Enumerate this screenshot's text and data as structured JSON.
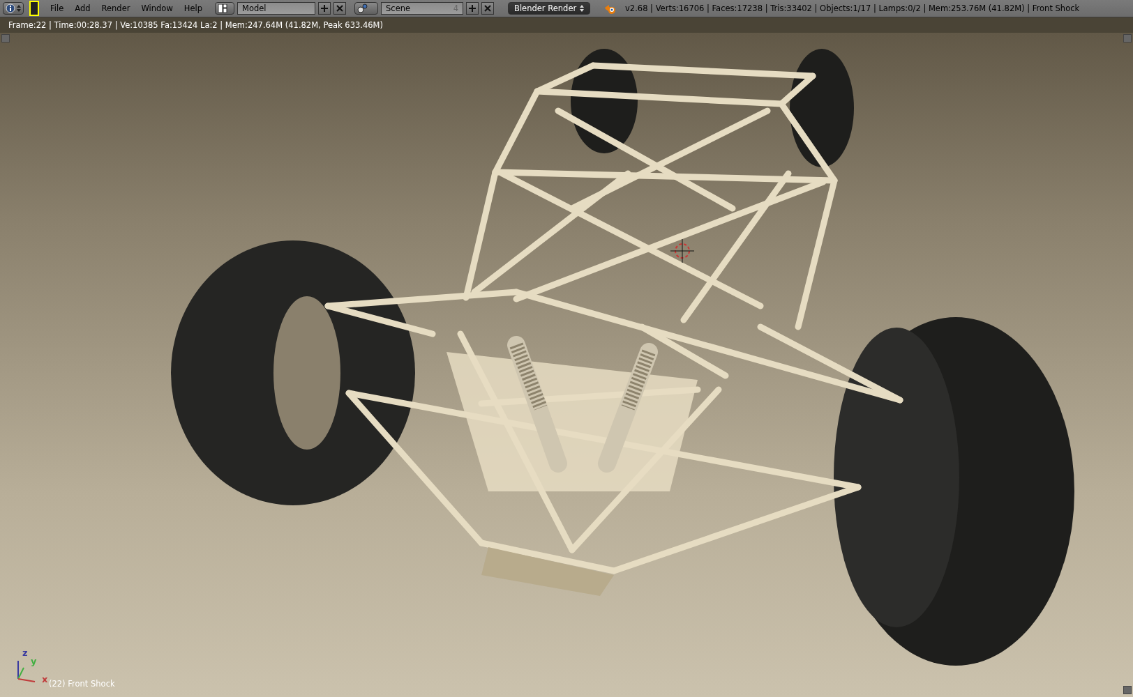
{
  "header": {
    "menus": [
      "File",
      "Add",
      "Render",
      "Window",
      "Help"
    ],
    "screen_layout": {
      "value": "Model"
    },
    "scene": {
      "value": "Scene",
      "users": "4"
    },
    "render_engine": {
      "value": "Blender Render"
    },
    "stats": "v2.68 | Verts:16706 | Faces:17238 | Tris:33402 | Objects:1/17 | Lamps:0/2 | Mem:253.76M (41.82M) | Front Shock"
  },
  "viewport": {
    "render_info": "Frame:22 | Time:00:28.37 | Ve:10385 Fa:13424 La:2 | Mem:247.64M (41.82M, Peak 633.46M)",
    "axes": [
      {
        "label": "z",
        "color": "#3a3aa0"
      },
      {
        "label": "y",
        "color": "#40b040"
      },
      {
        "label": "x",
        "color": "#c03a3a"
      }
    ],
    "object_label": "(22) Front Shock"
  }
}
